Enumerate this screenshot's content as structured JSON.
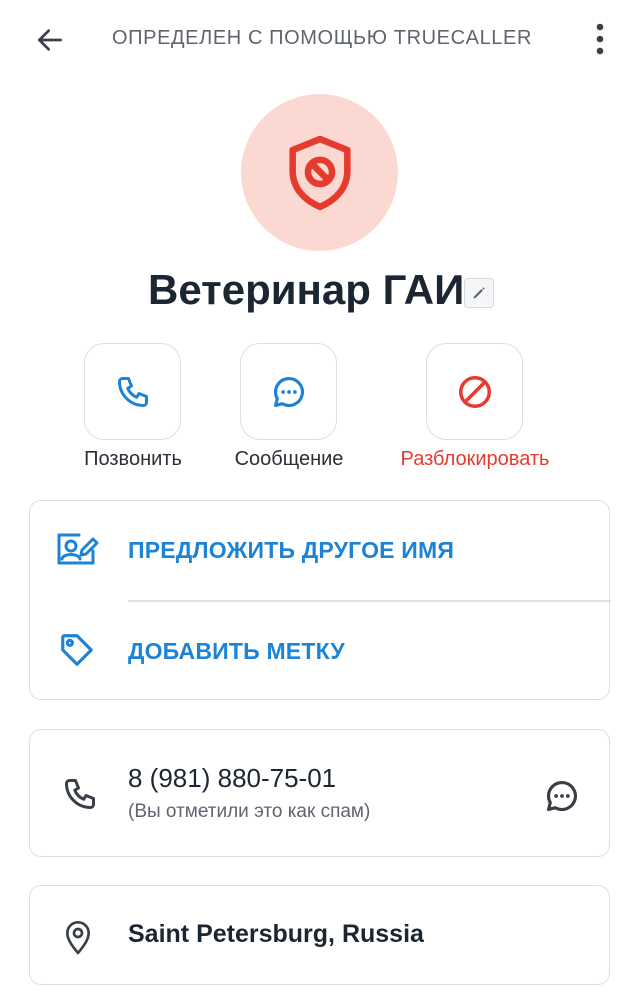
{
  "header": {
    "title": "ОПРЕДЕЛЕН С ПОМОЩЬЮ TRUECALLER",
    "back_icon": "arrow-left-icon",
    "menu_icon": "more-vertical-icon"
  },
  "contact": {
    "name": "Ветеринар ГАИ",
    "avatar_icon": "shield-block-icon",
    "avatar_bg": "#fcd8d2",
    "avatar_icon_color": "#e53b2f"
  },
  "actions": [
    {
      "label": "Позвонить",
      "icon": "phone-icon",
      "color": "#1d83d6"
    },
    {
      "label": "Сообщение",
      "icon": "chat-bubble-icon",
      "color": "#1d83d6"
    },
    {
      "label": "Разблокировать",
      "icon": "block-icon",
      "color": "#e53b2f"
    }
  ],
  "suggestions": [
    {
      "label": "ПРЕДЛОЖИТЬ ДРУГОЕ ИМЯ",
      "icon": "edit-contact-card-icon"
    },
    {
      "label": "ДОБАВИТЬ МЕТКУ",
      "icon": "tag-icon"
    }
  ],
  "phone": {
    "number": "8 (981) 880-75-01",
    "note": "(Вы отметили это как спам)",
    "icon": "phone-icon",
    "message_icon": "chat-bubble-icon"
  },
  "location": {
    "text": "Saint Petersburg, Russia",
    "icon": "location-pin-icon"
  },
  "colors": {
    "accent": "#1d83d6",
    "danger": "#e53b2f",
    "text": "#1c2633",
    "muted": "#5f6470",
    "border": "#dcdfe4"
  }
}
